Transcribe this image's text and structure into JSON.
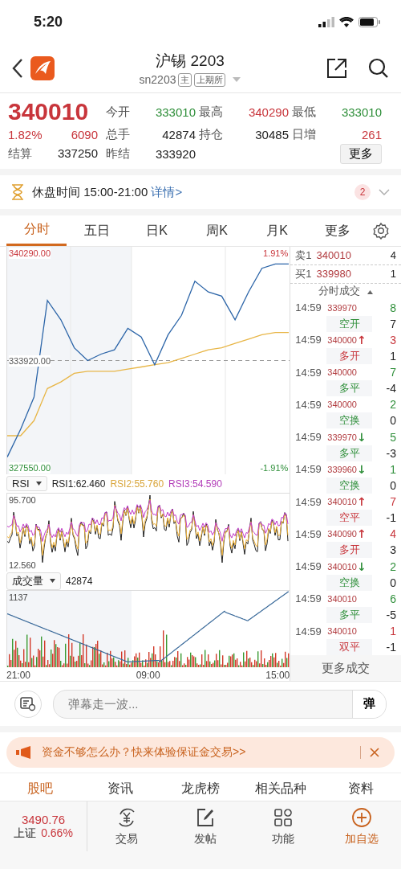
{
  "status_bar": {
    "time": "5:20"
  },
  "header": {
    "title": "沪锡 2203",
    "code": "sn2203",
    "badges": [
      "主",
      "上期所"
    ]
  },
  "quote": {
    "price": "340010",
    "change_pct": "1.82%",
    "change": "6090",
    "stats": [
      {
        "label": "今开",
        "value": "333010",
        "color": "#2f8f3a"
      },
      {
        "label": "最高",
        "value": "340290",
        "color": "#c8353b"
      },
      {
        "label": "最低",
        "value": "333010",
        "color": "#2f8f3a"
      },
      {
        "label": "总手",
        "value": "42874",
        "color": "#222222"
      },
      {
        "label": "持仓",
        "value": "30485",
        "color": "#222222"
      },
      {
        "label": "日增",
        "value": "261",
        "color": "#c8353b"
      },
      {
        "label": "昨结",
        "value": "333920",
        "color": "#222222"
      }
    ],
    "settlement": {
      "label": "结算",
      "value": "337250"
    },
    "more_button": "更多"
  },
  "notice": {
    "text": "休盘时间 15:00-21:00",
    "link": "详情>",
    "count": "2"
  },
  "chart_tabs": [
    {
      "label": "分时",
      "selected": true
    },
    {
      "label": "五日",
      "selected": false
    },
    {
      "label": "日K",
      "selected": false
    },
    {
      "label": "周K",
      "selected": false
    },
    {
      "label": "月K",
      "selected": false
    },
    {
      "label": "更多",
      "selected": false
    }
  ],
  "price_chart": {
    "high_pct": "1.91%",
    "low_pct": "-1.91%",
    "chart_data": {
      "type": "line",
      "series": [
        {
          "color": "#2c65a8",
          "values": [
            328190,
            329840,
            331750,
            337490,
            336340,
            334680,
            333920,
            334300,
            334560,
            335830,
            335320,
            333670,
            335450,
            336600,
            338630,
            337990,
            337740,
            336340,
            337990,
            339400,
            339650,
            339650
          ]
        },
        {
          "color": "#e8b647",
          "values": [
            329460,
            329460,
            330350,
            332260,
            332650,
            333160,
            333280,
            333280,
            333280,
            333410,
            333540,
            333670,
            333790,
            334050,
            334300,
            334560,
            334680,
            334940,
            335190,
            335450,
            335580,
            335580
          ]
        }
      ],
      "ylim": [
        327168,
        340672
      ],
      "yticks": [
        {
          "value": 340290,
          "label": "340290.00"
        },
        {
          "value": 333920,
          "label": "333920.00"
        },
        {
          "value": 327550,
          "label": "327550.00"
        }
      ]
    }
  },
  "rsi": {
    "selector": "RSI",
    "max": "95.700",
    "min": "12.560",
    "values": [
      {
        "text": "RSI1:62.460",
        "color": "#222222"
      },
      {
        "text": "RSI2:55.760",
        "color": "#d9a53a"
      },
      {
        "text": "RSI3:54.590",
        "color": "#b23cb8"
      }
    ]
  },
  "volume": {
    "selector": "成交量",
    "value": "42874",
    "max": "1137"
  },
  "time_axis": [
    "21:00",
    "09:00",
    "15:00"
  ],
  "order_book": [
    {
      "label": "卖1",
      "price": "340010",
      "qty": "4"
    },
    {
      "label": "买1",
      "price": "339980",
      "qty": "1"
    }
  ],
  "trades_title": "分时成交",
  "trades": [
    {
      "time": "14:59",
      "price": "339970",
      "volume": "8",
      "color": "#2f8f3a",
      "type": "空开",
      "change": "7"
    },
    {
      "time": "14:59",
      "price": "340000",
      "arrow": {
        "text": "↑",
        "color": "#c8353b"
      },
      "volume": "3",
      "color": "#c8353b",
      "type": "多开",
      "change": "1"
    },
    {
      "time": "14:59",
      "price": "340000",
      "volume": "7",
      "color": "#2f8f3a",
      "type": "多平",
      "change": "-4"
    },
    {
      "time": "14:59",
      "price": "340000",
      "volume": "2",
      "color": "#2f8f3a",
      "type": "空换",
      "change": "0"
    },
    {
      "time": "14:59",
      "price": "339970",
      "arrow": {
        "text": "↓",
        "color": "#2f8f3a"
      },
      "volume": "5",
      "color": "#2f8f3a",
      "type": "多平",
      "change": "-3"
    },
    {
      "time": "14:59",
      "price": "339960",
      "arrow": {
        "text": "↓",
        "color": "#2f8f3a"
      },
      "volume": "1",
      "color": "#2f8f3a",
      "type": "空换",
      "change": "0"
    },
    {
      "time": "14:59",
      "price": "340010",
      "arrow": {
        "text": "↑",
        "color": "#c8353b"
      },
      "volume": "7",
      "color": "#c8353b",
      "type": "空平",
      "change": "-1"
    },
    {
      "time": "14:59",
      "price": "340090",
      "arrow": {
        "text": "↑",
        "color": "#c8353b"
      },
      "volume": "4",
      "color": "#c8353b",
      "type": "多开",
      "change": "3"
    },
    {
      "time": "14:59",
      "price": "340010",
      "arrow": {
        "text": "↓",
        "color": "#2f8f3a"
      },
      "volume": "2",
      "color": "#2f8f3a",
      "type": "空换",
      "change": "0"
    },
    {
      "time": "14:59",
      "price": "340010",
      "volume": "6",
      "color": "#2f8f3a",
      "type": "多平",
      "change": "-5"
    },
    {
      "time": "14:59",
      "price": "340010",
      "volume": "1",
      "color": "#c8353b",
      "type": "双平",
      "change": "-1"
    }
  ],
  "more_trades": "更多成交",
  "danmu": {
    "placeholder": "弹幕走一波...",
    "send": "弹"
  },
  "ad": {
    "text": "资金不够怎么办？快来体验保证金交易>>"
  },
  "section_tabs": [
    {
      "label": "股吧",
      "selected": true
    },
    {
      "label": "资讯",
      "selected": false
    },
    {
      "label": "龙虎榜",
      "selected": false
    },
    {
      "label": "相关品种",
      "selected": false
    },
    {
      "label": "资料",
      "selected": false
    }
  ],
  "index": {
    "value": "3490.76",
    "name": "上证",
    "pct": "0.66%"
  },
  "nav": [
    {
      "label": "交易",
      "kind": "trade"
    },
    {
      "label": "发帖",
      "kind": "post"
    },
    {
      "label": "功能",
      "kind": "apps"
    },
    {
      "label": "加自选",
      "kind": "add"
    }
  ]
}
